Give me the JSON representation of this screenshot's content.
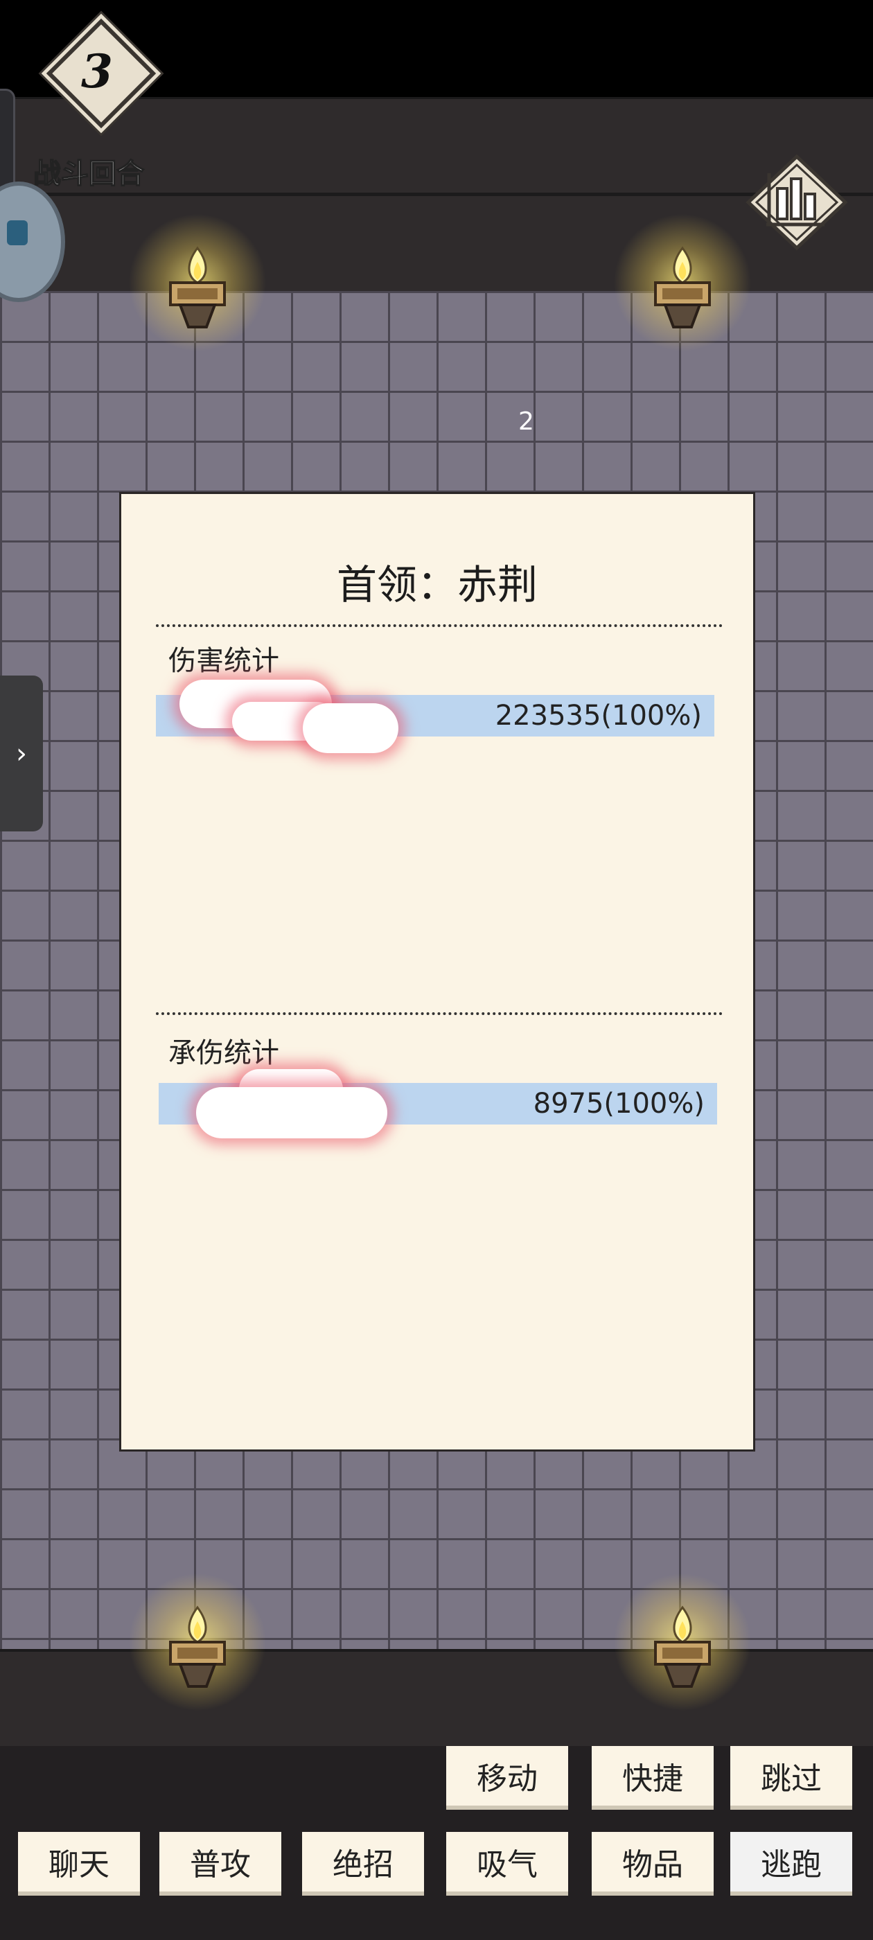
{
  "hud": {
    "round_number": "3",
    "round_label": "战斗回合"
  },
  "wall_marker": "2",
  "panel": {
    "title": "首领：赤荆",
    "damage_section": {
      "label": "伤害统计",
      "rows": [
        {
          "value": "223535(100%)"
        }
      ]
    },
    "taken_section": {
      "label": "承伤统计",
      "rows": [
        {
          "value": "8975(100%)"
        }
      ]
    }
  },
  "side_tab": {
    "icon": "chevron-right-icon",
    "glyph": "›"
  },
  "actions": {
    "row1": [
      "移动",
      "快捷",
      "跳过"
    ],
    "row2": [
      "聊天",
      "普攻",
      "绝招",
      "吸气",
      "物品",
      "逃跑"
    ]
  },
  "colors": {
    "panel_bg": "#fbf4e5",
    "bar_fill": "#bcd5ef",
    "wall": "#7b7685"
  }
}
